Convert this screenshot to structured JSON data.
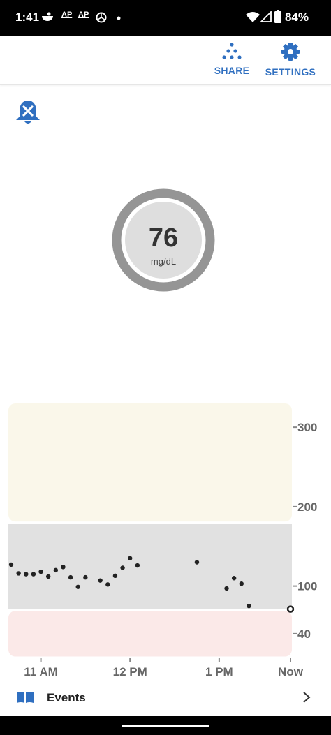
{
  "status_bar": {
    "time": "1:41",
    "notification_labels": [
      "AP",
      "AP"
    ],
    "battery": "84%"
  },
  "toolbar": {
    "share_label": "SHARE",
    "settings_label": "SETTINGS"
  },
  "alert": {
    "icon": "bell-off-icon"
  },
  "reading": {
    "value": "76",
    "unit": "mg/dL"
  },
  "chart_data": {
    "type": "scatter",
    "x_tick_labels": [
      "11 AM",
      "12 PM",
      "1 PM",
      "Now"
    ],
    "y_tick_labels": [
      "300",
      "200",
      "100",
      "40"
    ],
    "y_ticks": [
      300,
      200,
      100,
      40
    ],
    "ylim": [
      10,
      330
    ],
    "xlim": [
      "10:40",
      "13:48"
    ],
    "bands": [
      {
        "from": 180,
        "to": 330,
        "color": "#faf7ea"
      },
      {
        "from": 70,
        "to": 180,
        "color": "#e1e1e1"
      },
      {
        "from": 10,
        "to": 70,
        "color": "#fbe9e8"
      }
    ],
    "points": [
      {
        "x": "10:40",
        "y": 127
      },
      {
        "x": "10:45",
        "y": 116
      },
      {
        "x": "10:50",
        "y": 115
      },
      {
        "x": "10:55",
        "y": 115
      },
      {
        "x": "11:00",
        "y": 118
      },
      {
        "x": "11:05",
        "y": 112
      },
      {
        "x": "11:10",
        "y": 120
      },
      {
        "x": "11:15",
        "y": 124
      },
      {
        "x": "11:20",
        "y": 111
      },
      {
        "x": "11:25",
        "y": 99
      },
      {
        "x": "11:30",
        "y": 111
      },
      {
        "x": "11:40",
        "y": 107
      },
      {
        "x": "11:45",
        "y": 102
      },
      {
        "x": "11:50",
        "y": 113
      },
      {
        "x": "11:55",
        "y": 123
      },
      {
        "x": "12:00",
        "y": 135
      },
      {
        "x": "12:05",
        "y": 126
      },
      {
        "x": "12:45",
        "y": 130
      },
      {
        "x": "13:05",
        "y": 97
      },
      {
        "x": "13:10",
        "y": 110
      },
      {
        "x": "13:15",
        "y": 103
      },
      {
        "x": "13:20",
        "y": 75
      },
      {
        "x": "13:48",
        "y": 71,
        "current": true
      }
    ],
    "colors": {
      "point": "#222222",
      "tick_text": "#666666",
      "tick_mark": "#888888"
    }
  },
  "bottom_bar": {
    "events_label": "Events",
    "icon": "book-icon",
    "chevron": "chevron-right-icon"
  }
}
